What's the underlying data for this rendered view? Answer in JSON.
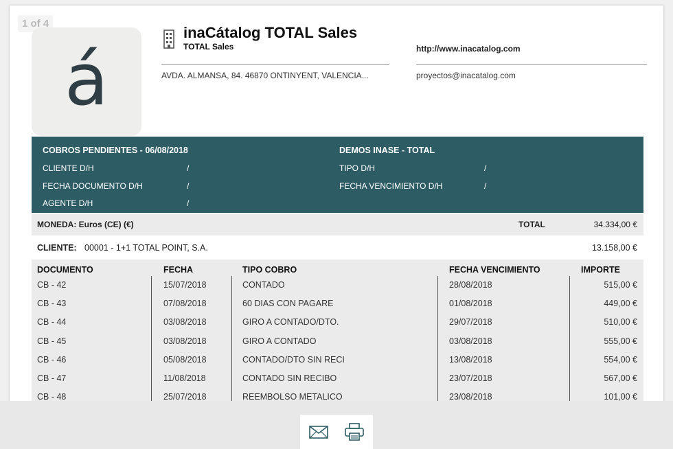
{
  "viewer": {
    "page_counter": "1 of 4"
  },
  "company": {
    "logo_char": "á",
    "name": "inaCátalog TOTAL Sales",
    "subtitle": "TOTAL Sales",
    "address": "AVDA. ALMANSA, 84. 46870 ONTINYENT, VALENCIA...",
    "website": "http://www.inacatalog.com",
    "email": "proyectos@inacatalog.com"
  },
  "report": {
    "title": "COBROS PENDIENTES - 06/08/2018",
    "company_title": "DEMOS INASE - TOTAL",
    "filters_left": [
      {
        "label": "CLIENTE D/H",
        "value": "/"
      },
      {
        "label": "FECHA DOCUMENTO D/H",
        "value": "/"
      },
      {
        "label": "AGENTE D/H",
        "value": "/"
      }
    ],
    "filters_right": [
      {
        "label": "TIPO D/H",
        "value": "/"
      },
      {
        "label": "FECHA VENCIMIENTO D/H",
        "value": "/"
      }
    ],
    "currency": "MONEDA: Euros (CE) (€)",
    "total_label": "TOTAL",
    "total_value": "34.334,00 €"
  },
  "client": {
    "label": "CLIENTE:",
    "name": "00001 - 1+1 TOTAL POINT, S.A.",
    "amount": "13.158,00 €"
  },
  "table": {
    "headers": [
      "DOCUMENTO",
      "FECHA",
      "TIPO COBRO",
      "FECHA VENCIMIENTO",
      "IMPORTE"
    ],
    "rows": [
      [
        "CB - 42",
        "15/07/2018",
        "CONTADO",
        "28/08/2018",
        "515,00 €"
      ],
      [
        "CB - 43",
        "07/08/2018",
        "60 DIAS CON PAGARE",
        "01/08/2018",
        "449,00 €"
      ],
      [
        "CB - 44",
        "03/08/2018",
        "GIRO A CONTADO/DTO.",
        "29/07/2018",
        "510,00 €"
      ],
      [
        "CB - 45",
        "03/08/2018",
        "GIRO A CONTADO",
        "03/08/2018",
        "555,00 €"
      ],
      [
        "CB - 46",
        "05/08/2018",
        "CONTADO/DTO SIN RECI",
        "13/08/2018",
        "554,00 €"
      ],
      [
        "CB - 47",
        "11/08/2018",
        "CONTADO SIN RECIBO",
        "23/07/2018",
        "567,00 €"
      ],
      [
        "CB - 48",
        "25/07/2018",
        "REEMBOLSO METALICO",
        "23/08/2018",
        "101,00 €"
      ]
    ]
  },
  "actions": {
    "email_icon": "envelope-icon",
    "print_icon": "printer-icon"
  },
  "colors": {
    "band": "#2e5c65",
    "summary_bg": "#ebebeb",
    "page_bg": "#ffffff",
    "viewer_bg": "#e8e8e8"
  }
}
